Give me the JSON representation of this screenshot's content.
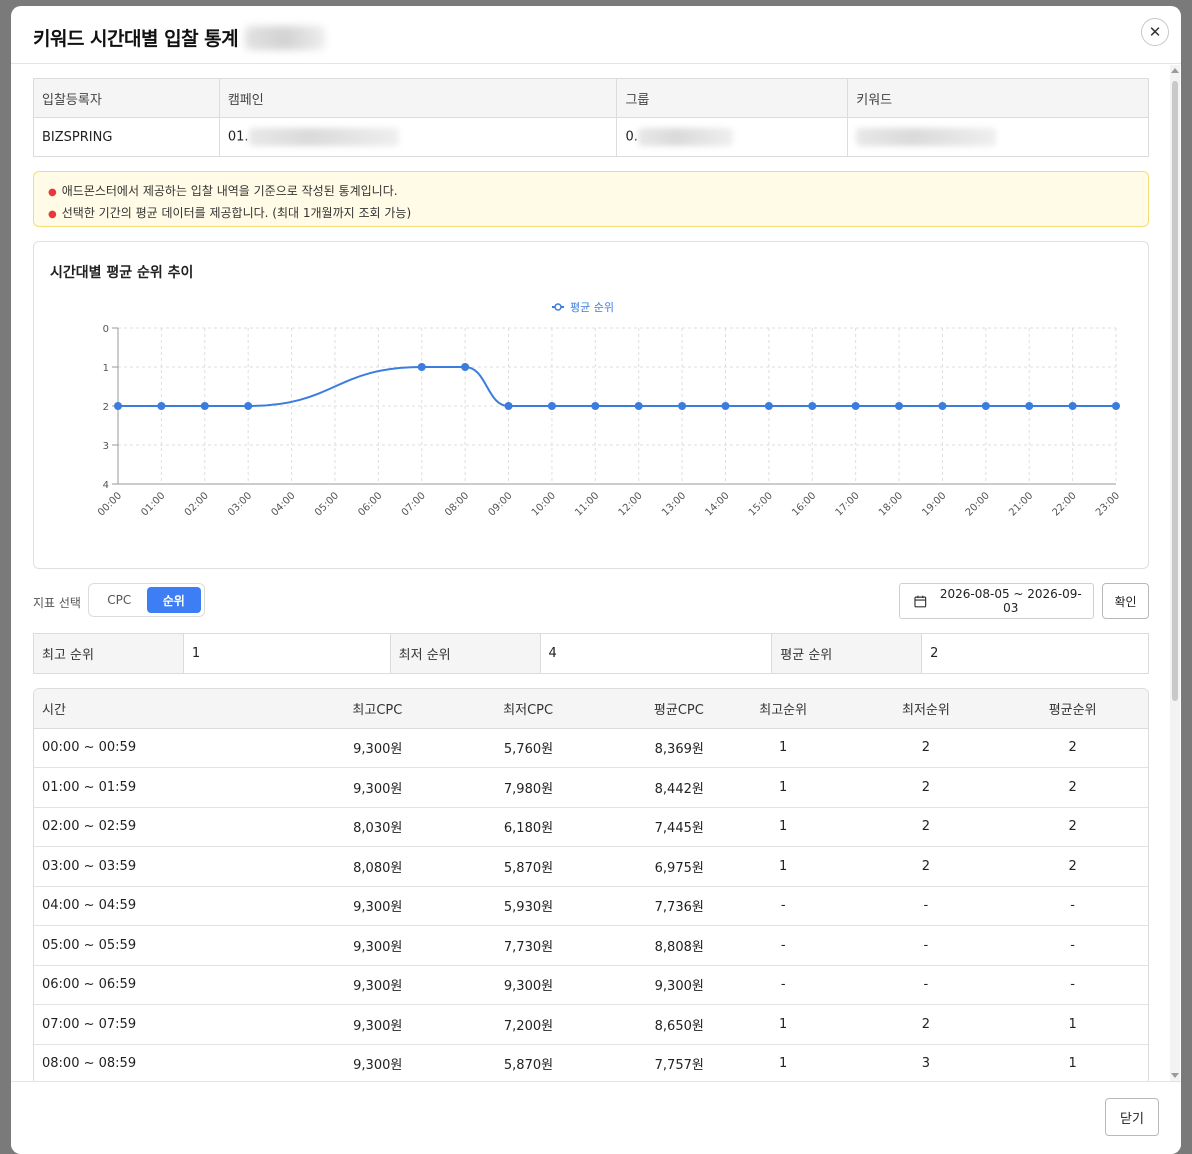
{
  "modal": {
    "title": "키워드 시간대별 입찰 통계",
    "close_label": "닫기"
  },
  "info": {
    "headers": [
      "입찰등록자",
      "캠페인",
      "그룹",
      "키워드"
    ],
    "values": [
      "BIZSPRING",
      "01.",
      "0.",
      ""
    ]
  },
  "notice": [
    "애드몬스터에서 제공하는 입찰 내역을 기준으로 작성된 통계입니다.",
    "선택한 기간의 평균 데이터를 제공합니다. (최대 1개월까지 조회 가능)"
  ],
  "chart_title": "시간대별 평균 순위 추이",
  "chart_data": {
    "type": "line",
    "categories": [
      "00:00",
      "01:00",
      "02:00",
      "03:00",
      "04:00",
      "05:00",
      "06:00",
      "07:00",
      "08:00",
      "09:00",
      "10:00",
      "11:00",
      "12:00",
      "13:00",
      "14:00",
      "15:00",
      "16:00",
      "17:00",
      "18:00",
      "19:00",
      "20:00",
      "21:00",
      "22:00",
      "23:00"
    ],
    "series": [
      {
        "name": "평균 순위",
        "values": [
          2,
          2,
          2,
          2,
          null,
          null,
          null,
          1,
          1,
          2,
          2,
          2,
          2,
          2,
          2,
          2,
          2,
          2,
          2,
          2,
          2,
          2,
          2,
          2
        ]
      }
    ],
    "ylim": [
      0,
      4
    ],
    "yticks": [
      0,
      1,
      2,
      3,
      4
    ],
    "y_inverted": true,
    "grid": true,
    "legend": "top-center",
    "color": "#3b7ddd"
  },
  "controls": {
    "metric_label": "지표 선택",
    "cpc_label": "CPC",
    "rank_label": "순위",
    "date_range": "2026-08-05 ~ 2026-09-03",
    "confirm_label": "확인"
  },
  "summary": {
    "best_label": "최고 순위",
    "best_value": "1",
    "worst_label": "최저 순위",
    "worst_value": "4",
    "avg_label": "평균 순위",
    "avg_value": "2"
  },
  "table": {
    "headers": [
      "시간",
      "최고CPC",
      "최저CPC",
      "평균CPC",
      "최고순위",
      "최저순위",
      "평균순위"
    ],
    "rows": [
      [
        "00:00 ~ 00:59",
        "9,300원",
        "5,760원",
        "8,369원",
        "1",
        "2",
        "2"
      ],
      [
        "01:00 ~ 01:59",
        "9,300원",
        "7,980원",
        "8,442원",
        "1",
        "2",
        "2"
      ],
      [
        "02:00 ~ 02:59",
        "8,030원",
        "6,180원",
        "7,445원",
        "1",
        "2",
        "2"
      ],
      [
        "03:00 ~ 03:59",
        "8,080원",
        "5,870원",
        "6,975원",
        "1",
        "2",
        "2"
      ],
      [
        "04:00 ~ 04:59",
        "9,300원",
        "5,930원",
        "7,736원",
        "-",
        "-",
        "-"
      ],
      [
        "05:00 ~ 05:59",
        "9,300원",
        "7,730원",
        "8,808원",
        "-",
        "-",
        "-"
      ],
      [
        "06:00 ~ 06:59",
        "9,300원",
        "9,300원",
        "9,300원",
        "-",
        "-",
        "-"
      ],
      [
        "07:00 ~ 07:59",
        "9,300원",
        "7,200원",
        "8,650원",
        "1",
        "2",
        "1"
      ],
      [
        "08:00 ~ 08:59",
        "9,300원",
        "5,870원",
        "7,757원",
        "1",
        "3",
        "1"
      ]
    ]
  }
}
